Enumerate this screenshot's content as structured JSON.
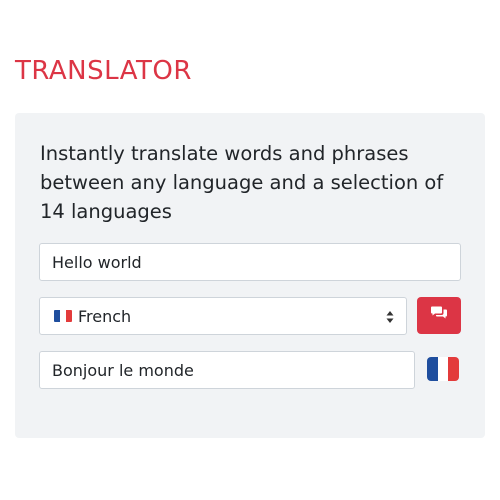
{
  "app": {
    "title": "TRANSLATOR"
  },
  "panel": {
    "description": "Instantly translate words and phrases between any language and a selection of 14 languages"
  },
  "source": {
    "value": "Hello world"
  },
  "language_select": {
    "selected": "French",
    "flag_icon": "flag-fr-icon"
  },
  "translate_button": {
    "icon": "comments-icon"
  },
  "output": {
    "value": "Bonjour le monde",
    "flag_icon": "flag-fr-icon"
  },
  "colors": {
    "accent": "#dc3545",
    "panel_bg": "#f1f3f5",
    "border": "#ced4da"
  }
}
